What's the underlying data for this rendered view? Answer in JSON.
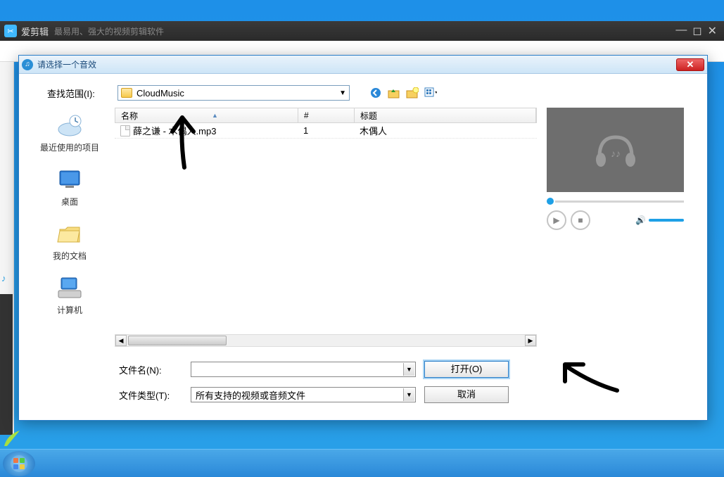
{
  "parent": {
    "title": "爱剪辑",
    "subtitle": "最易用、强大的视频剪辑软件"
  },
  "dialog": {
    "title": "请选择一个音效",
    "look_in_label": "查找范围(I):",
    "look_in_value": "CloudMusic",
    "columns": {
      "name": "名称",
      "num": "#",
      "title": "标题"
    },
    "rows": [
      {
        "name": "薛之谦 - 木偶人.mp3",
        "num": "1",
        "title": "木偶人"
      }
    ],
    "filename_label": "文件名(N):",
    "filename_value": "",
    "filetype_label": "文件类型(T):",
    "filetype_value": "所有支持的视频或音频文件",
    "open_btn": "打开(O)",
    "cancel_btn": "取消"
  },
  "sidebar": {
    "recent": "最近使用的项目",
    "desktop": "桌面",
    "documents": "我的文档",
    "computer": "计算机"
  }
}
